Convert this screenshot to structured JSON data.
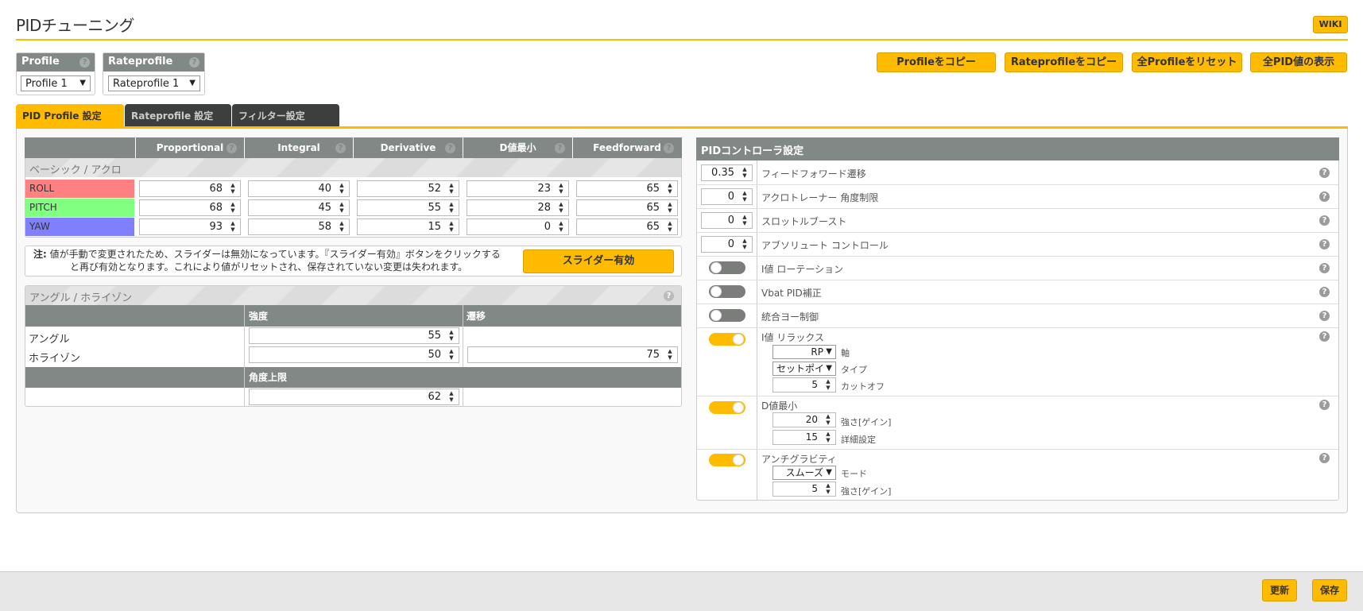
{
  "title": "PIDチューニング",
  "wiki": "WIKI",
  "profile": {
    "label": "Profile",
    "value": "Profile 1"
  },
  "rateprofile": {
    "label": "Rateprofile",
    "value": "Rateprofile 1"
  },
  "top_buttons": {
    "copy_profile": "Profileをコピー",
    "copy_rateprofile": "Rateprofileをコピー",
    "reset_all": "全Profileをリセット",
    "show_all_pid": "全PID値の表示"
  },
  "tabs": [
    {
      "label": "PID Profile 設定"
    },
    {
      "label": "Rateprofile 設定"
    },
    {
      "label": "フィルター設定"
    }
  ],
  "pid_table": {
    "columns": [
      "Proportional",
      "Integral",
      "Derivative",
      "D値最小",
      "Feedforward"
    ],
    "section": "ベーシック / アクロ",
    "rows": [
      {
        "axis": "ROLL",
        "color": "#ff8080",
        "values": [
          "68",
          "40",
          "52",
          "23",
          "65"
        ]
      },
      {
        "axis": "PITCH",
        "color": "#80ff80",
        "values": [
          "68",
          "45",
          "55",
          "28",
          "65"
        ]
      },
      {
        "axis": "YAW",
        "color": "#8080ff",
        "values": [
          "93",
          "58",
          "15",
          "0",
          "65"
        ]
      }
    ]
  },
  "note": {
    "prefix": "注:",
    "line1": "値が手動で変更されたため、スライダーは無効になっています。『スライダー有効』ボタンをクリックする",
    "line2": "と再び有効となります。これにより値がリセットされ、保存されていない変更は失われます。",
    "button": "スライダー有効"
  },
  "angle": {
    "section": "アングル / ホライゾン",
    "col_strength": "強度",
    "col_transition": "遷移",
    "rows": [
      {
        "label": "アングル",
        "strength": "55"
      },
      {
        "label": "ホライゾン",
        "strength": "50",
        "transition": "75"
      }
    ],
    "limit_label": "角度上限",
    "limit_value": "62"
  },
  "controller": {
    "title": "PIDコントローラ設定",
    "rows": [
      {
        "value": "0.35",
        "label": "フィードフォワード遷移"
      },
      {
        "value": "0",
        "label": "アクロトレーナー 角度制限"
      },
      {
        "value": "0",
        "label": "スロットルブースト"
      },
      {
        "value": "0",
        "label": "アブソリュート コントロール"
      },
      {
        "toggle": "off",
        "label": "I値 ローテーション"
      },
      {
        "toggle": "off",
        "label": "Vbat PID補正"
      },
      {
        "toggle": "off",
        "label": "統合ヨー制御"
      }
    ],
    "irelax": {
      "label": "I値 リラックス",
      "toggle": "on",
      "axis_value": "RP",
      "axis_label": "軸",
      "type_value": "セットポイ",
      "type_label": "タイプ",
      "cutoff_value": "5",
      "cutoff_label": "カットオフ"
    },
    "dmin": {
      "label": "D値最小",
      "toggle": "on",
      "gain_value": "20",
      "gain_label": "強さ[ゲイン]",
      "adv_value": "15",
      "adv_label": "詳細設定"
    },
    "antigravity": {
      "label": "アンチグラビティ",
      "toggle": "on",
      "mode_value": "スムーズ",
      "mode_label": "モード",
      "gain_value": "5",
      "gain_label": "強さ[ゲイン]"
    }
  },
  "footer": {
    "refresh": "更新",
    "save": "保存"
  },
  "colors": {
    "accent": "#ffbb00",
    "header_gray": "#828885",
    "tab_dark": "#3d3f3e"
  }
}
